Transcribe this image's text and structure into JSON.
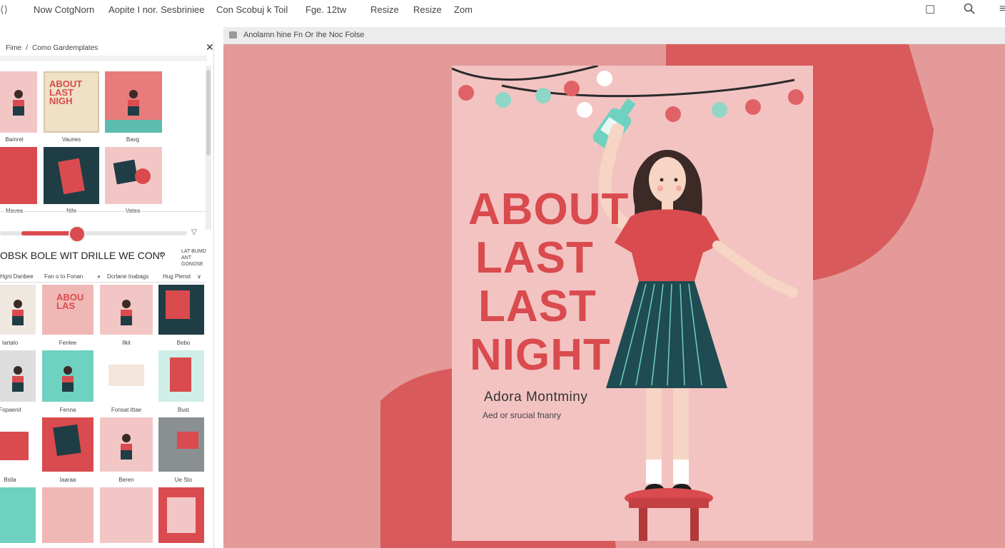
{
  "toolbar": {
    "menu": [
      "Now CotgNorn",
      "Aopite I nor. Sesbriniee",
      "Con Scobuj k Toil",
      "Fge. 12tw",
      "Resize",
      "Resize",
      "Zom"
    ]
  },
  "left_panel": {
    "breadcrumb": [
      "Fime",
      "Como Gardemplates"
    ],
    "templates_top": [
      {
        "caption": "Bamrel",
        "title": ""
      },
      {
        "caption": "Vaunes",
        "title": "ABOUT LAST NIGH"
      },
      {
        "caption": "Bavg",
        "title": ""
      },
      {
        "caption": "Mavea",
        "title": ""
      },
      {
        "caption": "Nile",
        "title": ""
      },
      {
        "caption": "Vatea",
        "title": ""
      }
    ],
    "slider": {
      "value_fraction": 0.35
    },
    "section_title": "OBSK BOLE WIT DRILLE WE CON?",
    "section_side": [
      "LAT BUMD",
      "ANT GONOSE"
    ],
    "filters": [
      "Hgni Danbee",
      "Fan o Io Fonan",
      "Dcrlane Inabags",
      "Hug Plenst"
    ],
    "templates_grid": [
      {
        "caption": "Iartalo",
        "title": ""
      },
      {
        "caption": "Fenlee",
        "title": "ABOU LAS"
      },
      {
        "caption": "Ilkit",
        "title": ""
      },
      {
        "caption": "Bebo",
        "title": ""
      },
      {
        "caption": "Fopaenit",
        "title": ""
      },
      {
        "caption": "Fenna",
        "title": ""
      },
      {
        "caption": "Fonsat Ittae",
        "title": ""
      },
      {
        "caption": "Bust",
        "title": ""
      },
      {
        "caption": "Bslla",
        "title": ""
      },
      {
        "caption": "Iaaraa",
        "title": ""
      },
      {
        "caption": "Beren",
        "title": ""
      },
      {
        "caption": "Ue Sto",
        "title": ""
      }
    ]
  },
  "canvas": {
    "doc_title": "Anolamn hine Fn Or Ihe Noc Folse",
    "cover": {
      "title_lines": [
        "ABOUT",
        "LAST",
        "LAST",
        "NIGHT"
      ],
      "author": "Adora Montminy",
      "subtitle": "Aed or srucial fnanry"
    }
  },
  "colors": {
    "accent": "#d94b4e",
    "teal": "#6fd1c0",
    "dark": "#1f3d44",
    "cover_bg": "#f3c3c2",
    "canvas_bg": "#e39a98"
  }
}
